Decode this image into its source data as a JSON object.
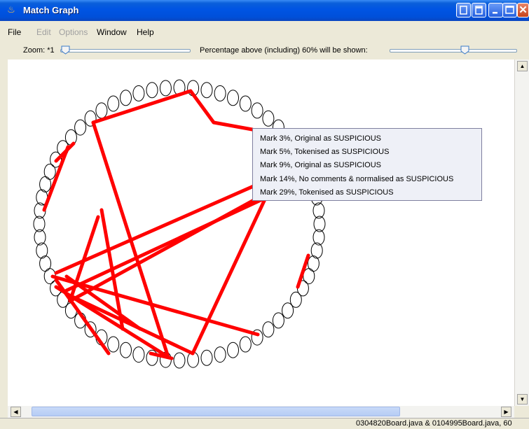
{
  "window": {
    "title": "Match Graph"
  },
  "menu": [
    "File",
    "Edit",
    "Options",
    "Window",
    "Help"
  ],
  "toolbar": {
    "zoom_label": "Zoom: *1",
    "percentage_label": "Percentage above (including) 60% will be shown:"
  },
  "tooltip": {
    "items": [
      "Mark 3%, Original as SUSPICIOUS",
      "Mark 5%, Tokenised as SUSPICIOUS",
      "Mark 9%, Original as SUSPICIOUS",
      "Mark 14%, No comments & normalised as SUSPICIOUS",
      "Mark 29%, Tokenised as SUSPICIOUS"
    ]
  },
  "status": {
    "text": "0304820Board.java & 0104995Board.java, 60"
  },
  "colors": {
    "edge": "#FF0000",
    "node_stroke": "#000000",
    "titlebar": "#0054E3"
  }
}
